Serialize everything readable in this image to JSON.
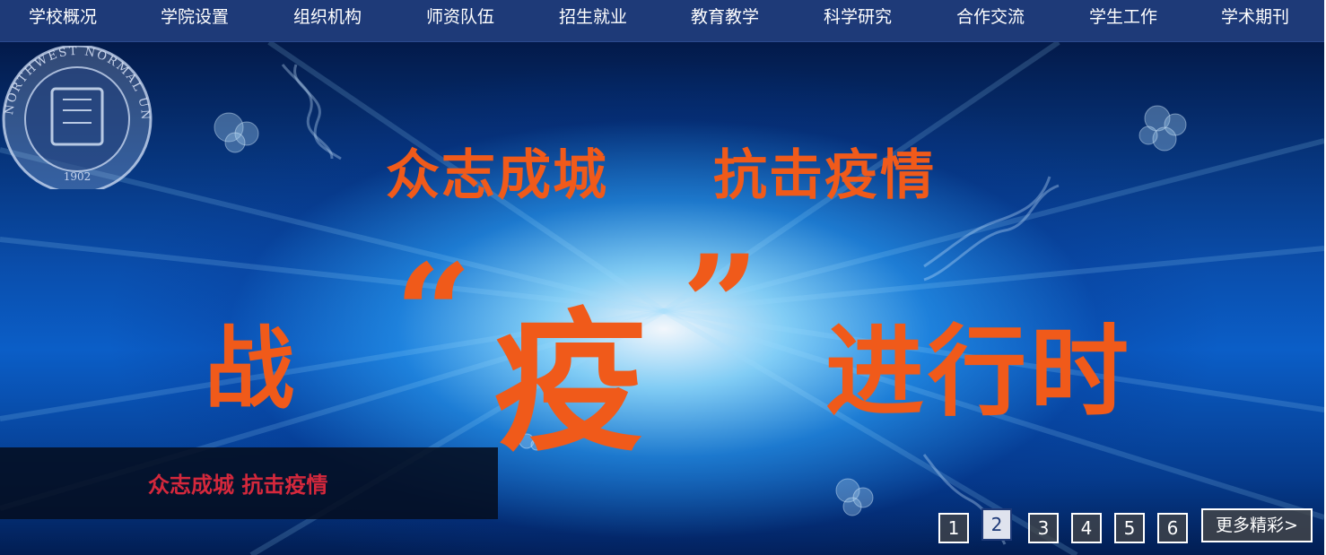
{
  "nav": {
    "items": [
      {
        "label": "学校概况"
      },
      {
        "label": "学院设置"
      },
      {
        "label": "组织机构"
      },
      {
        "label": "师资队伍"
      },
      {
        "label": "招生就业"
      },
      {
        "label": "教育教学"
      },
      {
        "label": "科学研究"
      },
      {
        "label": "合作交流"
      },
      {
        "label": "学生工作"
      },
      {
        "label": "学术期刊"
      }
    ]
  },
  "banner": {
    "headline_top_a": "众志成城",
    "headline_top_b": "抗击疫情",
    "headline_main_left": "战",
    "quote_open": "“",
    "headline_main_center": "疫",
    "quote_close": "”",
    "headline_main_right": "进行时",
    "caption": "众志成城 抗击疫情",
    "seal": {
      "icon": "university-seal-icon",
      "ring_text": "NORTHWEST NORMAL UNIVERSITY",
      "year": "1902"
    },
    "text_color": "#f05a1a"
  },
  "pager": {
    "pages": [
      "1",
      "2",
      "3",
      "4",
      "5",
      "6"
    ],
    "active": "2",
    "more_label": "更多精彩>"
  },
  "colors": {
    "nav_bg": "#1e3a78",
    "caption_text": "#d4283c"
  }
}
